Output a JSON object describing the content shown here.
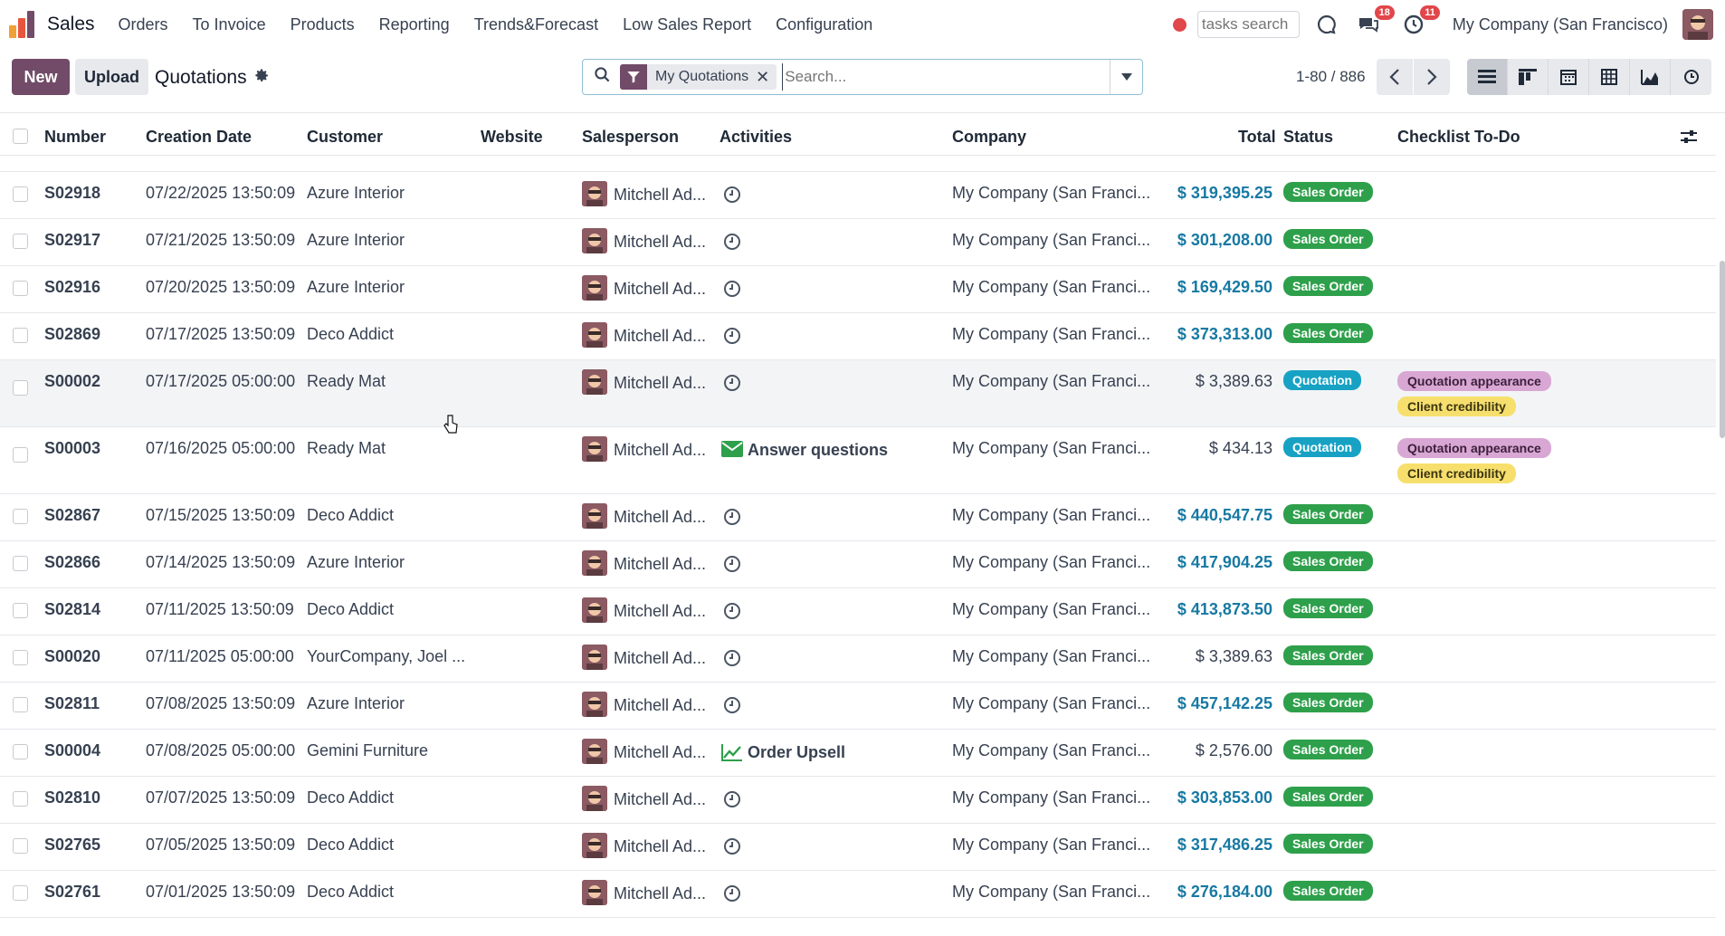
{
  "navbar": {
    "app_name": "Sales",
    "menu": [
      "Orders",
      "To Invoice",
      "Products",
      "Reporting",
      "Trends&Forecast",
      "Low Sales Report",
      "Configuration"
    ],
    "tasks_search_placeholder": "tasks search",
    "messages_badge": "18",
    "activities_badge": "11",
    "company": "My Company (San Francisco)"
  },
  "control": {
    "new_label": "New",
    "upload_label": "Upload",
    "title": "Quotations",
    "facet": "My Quotations",
    "search_placeholder": "Search...",
    "pager": "1-80 / 886"
  },
  "columns": {
    "number": "Number",
    "creation_date": "Creation Date",
    "customer": "Customer",
    "website": "Website",
    "salesperson": "Salesperson",
    "activities": "Activities",
    "company": "Company",
    "total": "Total",
    "status": "Status",
    "checklist": "Checklist To-Do"
  },
  "rows": [
    {
      "number": "S02918",
      "date": "07/22/2025 13:50:09",
      "customer": "Azure Interior",
      "salesperson": "Mitchell Ad...",
      "activity": "",
      "company": "My Company (San Franci...",
      "total": "$ 319,395.25",
      "status": "Sales Order",
      "tags": []
    },
    {
      "number": "S02917",
      "date": "07/21/2025 13:50:09",
      "customer": "Azure Interior",
      "salesperson": "Mitchell Ad...",
      "activity": "",
      "company": "My Company (San Franci...",
      "total": "$ 301,208.00",
      "status": "Sales Order",
      "tags": []
    },
    {
      "number": "S02916",
      "date": "07/20/2025 13:50:09",
      "customer": "Azure Interior",
      "salesperson": "Mitchell Ad...",
      "activity": "",
      "company": "My Company (San Franci...",
      "total": "$ 169,429.50",
      "status": "Sales Order",
      "tags": []
    },
    {
      "number": "S02869",
      "date": "07/17/2025 13:50:09",
      "customer": "Deco Addict",
      "salesperson": "Mitchell Ad...",
      "activity": "",
      "company": "My Company (San Franci...",
      "total": "$ 373,313.00",
      "status": "Sales Order",
      "tags": []
    },
    {
      "number": "S00002",
      "date": "07/17/2025 05:00:00",
      "customer": "Ready Mat",
      "salesperson": "Mitchell Ad...",
      "activity": "",
      "company": "My Company (San Franci...",
      "total": "$ 3,389.63",
      "status": "Quotation",
      "tags": [
        "Quotation appearance",
        "Client credibility"
      ]
    },
    {
      "number": "S00003",
      "date": "07/16/2025 05:00:00",
      "customer": "Ready Mat",
      "salesperson": "Mitchell Ad...",
      "activity": "Answer questions",
      "company": "My Company (San Franci...",
      "total": "$ 434.13",
      "status": "Quotation",
      "tags": [
        "Quotation appearance",
        "Client credibility"
      ]
    },
    {
      "number": "S02867",
      "date": "07/15/2025 13:50:09",
      "customer": "Deco Addict",
      "salesperson": "Mitchell Ad...",
      "activity": "",
      "company": "My Company (San Franci...",
      "total": "$ 440,547.75",
      "status": "Sales Order",
      "tags": []
    },
    {
      "number": "S02866",
      "date": "07/14/2025 13:50:09",
      "customer": "Azure Interior",
      "salesperson": "Mitchell Ad...",
      "activity": "",
      "company": "My Company (San Franci...",
      "total": "$ 417,904.25",
      "status": "Sales Order",
      "tags": []
    },
    {
      "number": "S02814",
      "date": "07/11/2025 13:50:09",
      "customer": "Deco Addict",
      "salesperson": "Mitchell Ad...",
      "activity": "",
      "company": "My Company (San Franci...",
      "total": "$ 413,873.50",
      "status": "Sales Order",
      "tags": []
    },
    {
      "number": "S00020",
      "date": "07/11/2025 05:00:00",
      "customer": "YourCompany, Joel ...",
      "salesperson": "Mitchell Ad...",
      "activity": "",
      "company": "My Company (San Franci...",
      "total": "$ 3,389.63",
      "status": "Sales Order",
      "tags": []
    },
    {
      "number": "S02811",
      "date": "07/08/2025 13:50:09",
      "customer": "Azure Interior",
      "salesperson": "Mitchell Ad...",
      "activity": "",
      "company": "My Company (San Franci...",
      "total": "$ 457,142.25",
      "status": "Sales Order",
      "tags": []
    },
    {
      "number": "S00004",
      "date": "07/08/2025 05:00:00",
      "customer": "Gemini Furniture",
      "salesperson": "Mitchell Ad...",
      "activity": "Order Upsell",
      "company": "My Company (San Franci...",
      "total": "$ 2,576.00",
      "status": "Sales Order",
      "tags": []
    },
    {
      "number": "S02810",
      "date": "07/07/2025 13:50:09",
      "customer": "Deco Addict",
      "salesperson": "Mitchell Ad...",
      "activity": "",
      "company": "My Company (San Franci...",
      "total": "$ 303,853.00",
      "status": "Sales Order",
      "tags": []
    },
    {
      "number": "S02765",
      "date": "07/05/2025 13:50:09",
      "customer": "Deco Addict",
      "salesperson": "Mitchell Ad...",
      "activity": "",
      "company": "My Company (San Franci...",
      "total": "$ 317,486.25",
      "status": "Sales Order",
      "tags": []
    },
    {
      "number": "S02761",
      "date": "07/01/2025 13:50:09",
      "customer": "Deco Addict",
      "salesperson": "Mitchell Ad...",
      "activity": "",
      "company": "My Company (San Franci...",
      "total": "$ 276,184.00",
      "status": "Sales Order",
      "tags": []
    }
  ],
  "colors": {
    "brand": "#714b67",
    "link": "#1779a3",
    "sales_order": "#2ea04b",
    "quotation": "#17a2c4",
    "tag_pink": "#d9a7d4",
    "tag_yellow": "#f7df6d",
    "badge": "#e0464a"
  }
}
